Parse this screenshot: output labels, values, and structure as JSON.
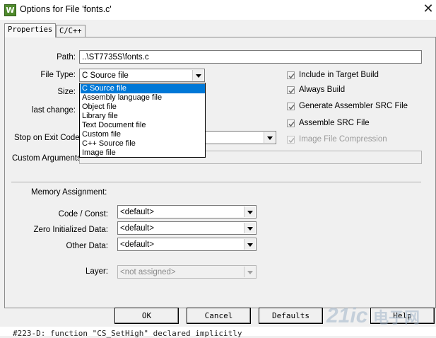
{
  "window": {
    "title": "Options for File 'fonts.c'",
    "app_icon": "W"
  },
  "tabs": [
    {
      "label": "Properties"
    },
    {
      "label": "C/C++"
    }
  ],
  "properties": {
    "path": {
      "label": "Path:",
      "value": "..\\ST7735S\\fonts.c"
    },
    "file_type": {
      "label": "File Type:",
      "value": "C Source file"
    },
    "size": {
      "label": "Size:"
    },
    "last_change": {
      "label": "last change:"
    },
    "stop_on_exit": {
      "label": "Stop on Exit Code:"
    },
    "custom_args": {
      "label": "Custom Arguments:"
    },
    "file_type_options": [
      "C Source file",
      "Assembly language file",
      "Object file",
      "Library file",
      "Text Document file",
      "Custom file",
      "C++ Source file",
      "Image file"
    ],
    "checkboxes": [
      {
        "label": "Include in Target Build",
        "checked": true,
        "enabled": true
      },
      {
        "label": "Always Build",
        "checked": true,
        "enabled": true
      },
      {
        "label": "Generate Assembler SRC File",
        "checked": true,
        "enabled": true
      },
      {
        "label": "Assemble SRC File",
        "checked": true,
        "enabled": true
      },
      {
        "label": "Image File Compression",
        "checked": true,
        "enabled": false
      }
    ]
  },
  "memory": {
    "section_label": "Memory Assignment:",
    "code_const": {
      "label": "Code / Const:",
      "value": "<default>"
    },
    "zero_init": {
      "label": "Zero Initialized Data:",
      "value": "<default>"
    },
    "other_data": {
      "label": "Other Data:",
      "value": "<default>"
    },
    "layer": {
      "label": "Layer:",
      "value": "<not assigned>"
    }
  },
  "buttons": {
    "ok": "OK",
    "cancel": "Cancel",
    "defaults": "Defaults",
    "help": "Help"
  },
  "background_text": "#223-D: function \"CS_SetHigh\" declared implicitly",
  "watermark": {
    "text": "21ic",
    "suffix": "电子网"
  },
  "colors": {
    "selection": "#0078d7",
    "accent": "#4f8a2c"
  }
}
